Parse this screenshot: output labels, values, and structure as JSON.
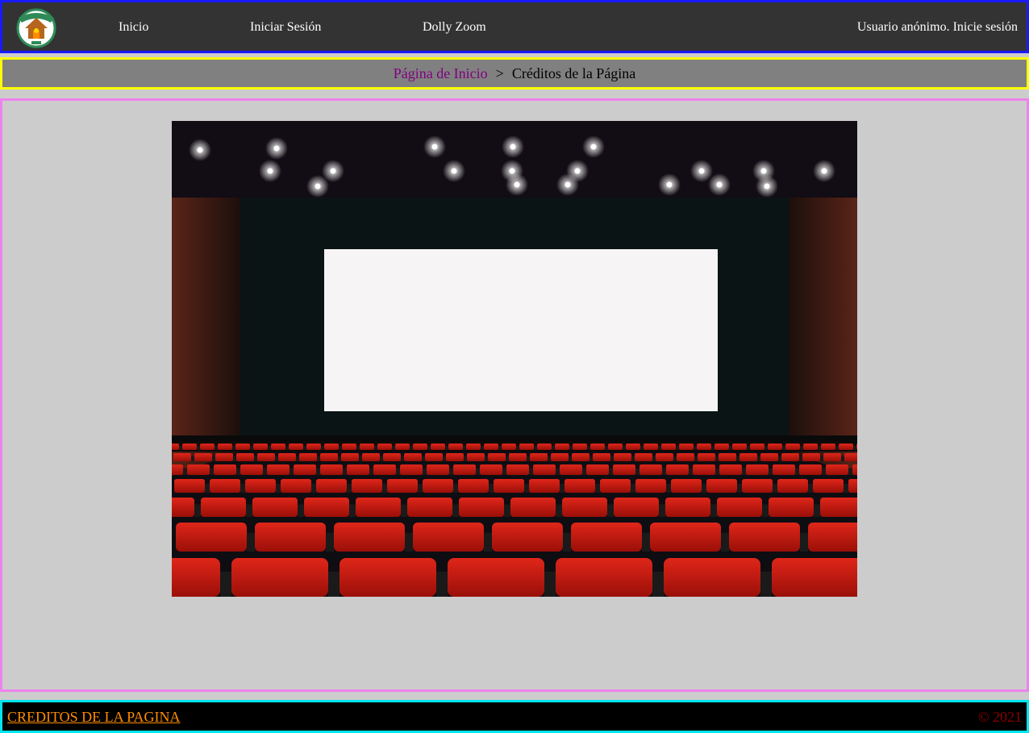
{
  "nav": {
    "items": [
      "Inicio",
      "Iniciar Sesión",
      "Dolly Zoom"
    ],
    "user_status": "Usuario anónimo. Inicie sesión"
  },
  "breadcrumb": {
    "home": "Página de Inicio",
    "separator": ">",
    "current": "Créditos de la Página"
  },
  "footer": {
    "credits_link": "CREDITOS DE LA PAGINA",
    "copyright": "© 2021"
  },
  "colors": {
    "topbar_border": "#1a1aff",
    "breadcrumb_border": "#ffff00",
    "main_border": "#ee82ee",
    "footer_border": "#00e5ee",
    "footer_link": "#ff8c00",
    "copyright": "#8b0000",
    "breadcrumb_link": "#800080"
  },
  "icons": {
    "logo": "house-emblem-logo"
  }
}
